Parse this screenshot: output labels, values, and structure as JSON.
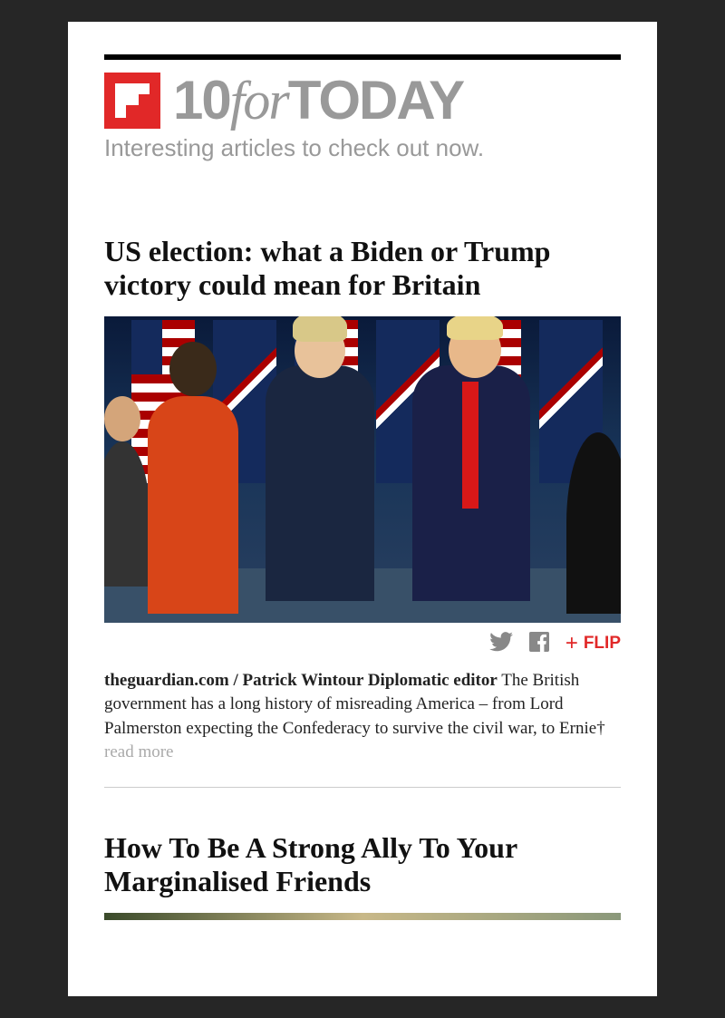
{
  "brand": {
    "ten": "10",
    "for": "for",
    "today": "TODAY",
    "tagline": "Interesting articles to check out now."
  },
  "share": {
    "flip_label": "FLIP"
  },
  "articles": [
    {
      "title": "US election: what a Biden or Trump victory could mean for Britain",
      "source": "theguardian.com / Patrick Wintour Diplomatic editor",
      "excerpt": " The British government has a long history of misreading America – from Lord Palmerston expecting the Confederacy to survive the civil war, to Ernie† ",
      "read_more": "read more"
    },
    {
      "title": "How To Be A Strong Ally To Your Marginalised Friends"
    }
  ]
}
